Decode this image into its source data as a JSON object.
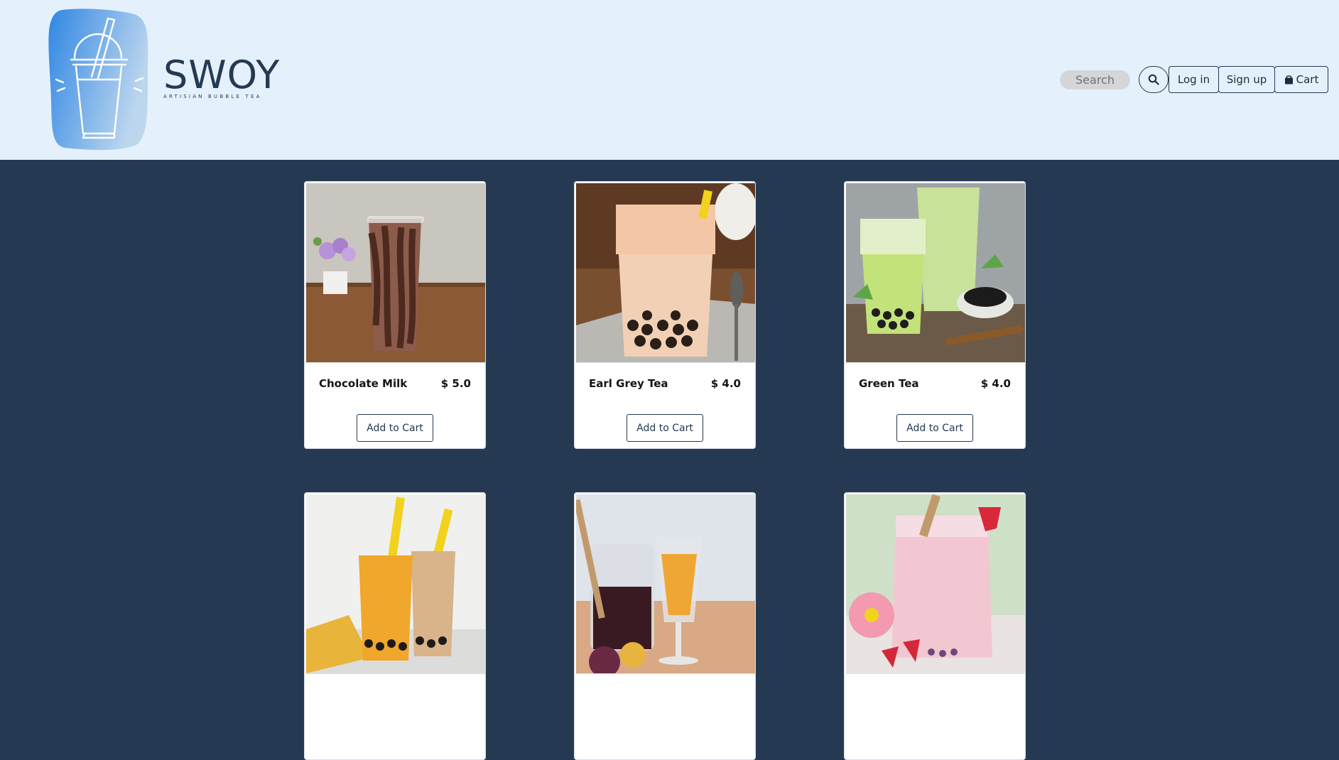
{
  "brand": {
    "name": "SWOY",
    "tagline": "ARTISIAN BUBBLE TEA",
    "colors": {
      "navy": "#253a52",
      "header_bg": "#e4f1fc",
      "logo_blue": "#2f86e4"
    }
  },
  "nav": {
    "search_placeholder": "Search",
    "search_icon": "search-icon",
    "login_label": "Log in",
    "signup_label": "Sign up",
    "cart_label": "Cart",
    "cart_icon": "shopping-bag-icon"
  },
  "products": [
    {
      "name": "Chocolate Milk",
      "price": "$ 5.0",
      "button": "Add to Cart",
      "image": "chocolate-milk-photo"
    },
    {
      "name": "Earl Grey Tea",
      "price": "$ 4.0",
      "button": "Add to Cart",
      "image": "earl-grey-tea-photo"
    },
    {
      "name": "Green Tea",
      "price": "$ 4.0",
      "button": "Add to Cart",
      "image": "green-tea-photo"
    },
    {
      "image": "mango-tea-photo"
    },
    {
      "image": "passion-fruit-tea-photo"
    },
    {
      "image": "strawberry-milk-photo"
    }
  ]
}
